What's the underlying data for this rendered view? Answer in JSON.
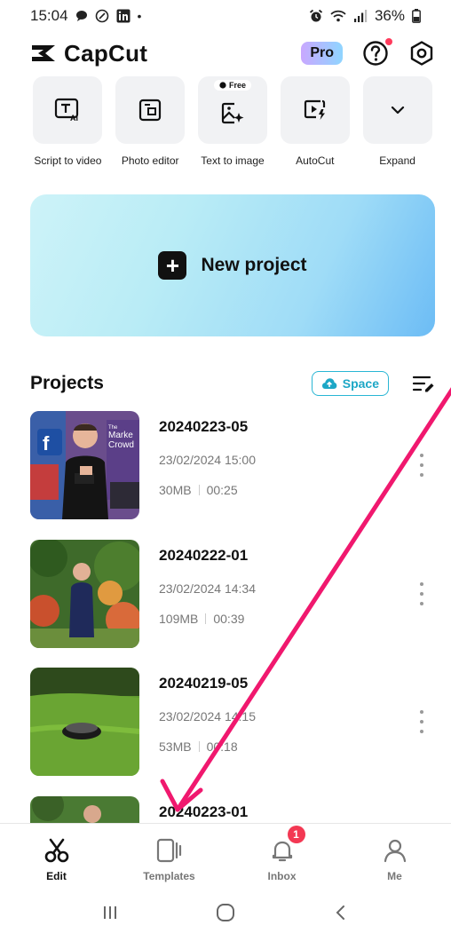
{
  "status_bar": {
    "time": "15:04",
    "battery": "36%"
  },
  "header": {
    "brand": "CapCut",
    "pro_label": "Pro"
  },
  "tools": [
    {
      "label": "Script to video",
      "icon": "text-ai-icon"
    },
    {
      "label": "Photo editor",
      "icon": "photo-editor-icon"
    },
    {
      "label": "Text to image",
      "icon": "image-sparkle-icon",
      "badge": "Free"
    },
    {
      "label": "AutoCut",
      "icon": "autocut-icon"
    },
    {
      "label": "Expand",
      "icon": "chevron-down-icon"
    }
  ],
  "new_project": {
    "label": "New project"
  },
  "projects": {
    "title": "Projects",
    "space_label": "Space",
    "items": [
      {
        "name": "20240223-05",
        "date": "23/02/2024 15:00",
        "size": "30MB",
        "duration": "00:25",
        "thumb_text": "The Marke Crowd"
      },
      {
        "name": "20240222-01",
        "date": "23/02/2024 14:34",
        "size": "109MB",
        "duration": "00:39"
      },
      {
        "name": "20240219-05",
        "date": "23/02/2024 14:15",
        "size": "53MB",
        "duration": "00:18"
      },
      {
        "name": "20240223-01"
      }
    ]
  },
  "bottom_nav": {
    "items": [
      {
        "label": "Edit",
        "icon": "scissors-icon",
        "active": true
      },
      {
        "label": "Templates",
        "icon": "templates-icon"
      },
      {
        "label": "Inbox",
        "icon": "bell-icon",
        "badge": "1"
      },
      {
        "label": "Me",
        "icon": "person-icon"
      }
    ]
  },
  "colors": {
    "accent_teal": "#1da7c6",
    "notification_red": "#f33853",
    "annotation_arrow": "#f0186e"
  }
}
